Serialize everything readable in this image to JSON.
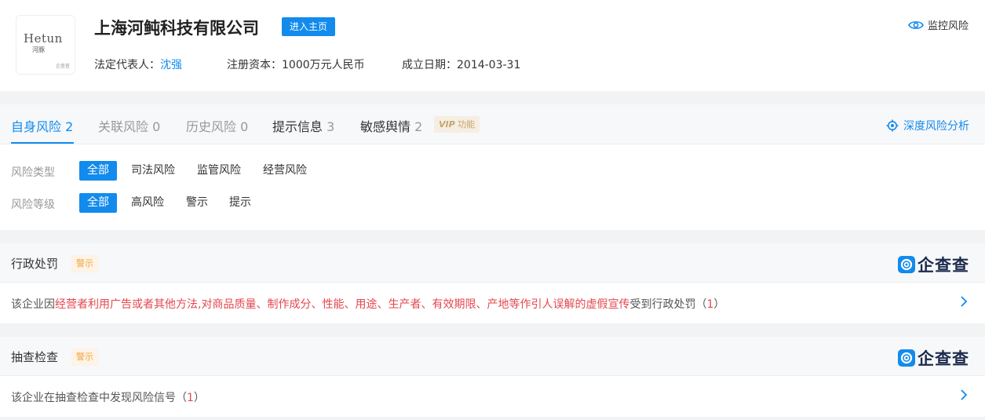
{
  "company": {
    "logo_text": "Hetun",
    "logo_sub": "河豚",
    "logo_small": "企查查",
    "name": "上海河鲀科技有限公司",
    "enter_label": "进入主页",
    "legal_rep_label": "法定代表人：",
    "legal_rep": "沈强",
    "capital_label": "注册资本：",
    "capital": "1000万元人民币",
    "founded_label": "成立日期：",
    "founded": "2014-03-31",
    "monitor_label": "监控风险"
  },
  "tabs": [
    {
      "label": "自身风险",
      "count": "2",
      "state": "active"
    },
    {
      "label": "关联风险",
      "count": "0",
      "state": "muted"
    },
    {
      "label": "历史风险",
      "count": "0",
      "state": "muted"
    },
    {
      "label": "提示信息",
      "count": "3",
      "state": "normal"
    },
    {
      "label": "敏感舆情",
      "count": "2",
      "state": "normal"
    }
  ],
  "vip": {
    "mark": "VIP",
    "text": "功能"
  },
  "deep_analysis": "深度风险分析",
  "filters": {
    "type_label": "风险类型",
    "type_options": [
      "全部",
      "司法风险",
      "监管风险",
      "经营风险"
    ],
    "level_label": "风险等级",
    "level_options": [
      "全部",
      "高风险",
      "警示",
      "提示"
    ]
  },
  "cards": [
    {
      "title": "行政处罚",
      "tag": "警示",
      "brand": "企查查",
      "prefix": "该企业因",
      "highlight": "经营者利用广告或者其他方法,对商品质量、制作成分、性能、用途、生产者、有效期限、产地等作引人误解的虚假宣传",
      "suffix": "受到行政处罚（",
      "count": "1",
      "close": "）"
    },
    {
      "title": "抽查检查",
      "tag": "警示",
      "brand": "企查查",
      "prefix": "该企业在抽查检查中发现风险信号（",
      "count": "1",
      "close": "）"
    }
  ],
  "colors": {
    "accent": "#128bed",
    "danger": "#e4474e",
    "warn": "#f0a53d"
  },
  "icons": {
    "monitor": "eye-icon",
    "deep": "target-icon",
    "brand": "qcc-logo-icon",
    "row": "chevron-right-icon"
  }
}
